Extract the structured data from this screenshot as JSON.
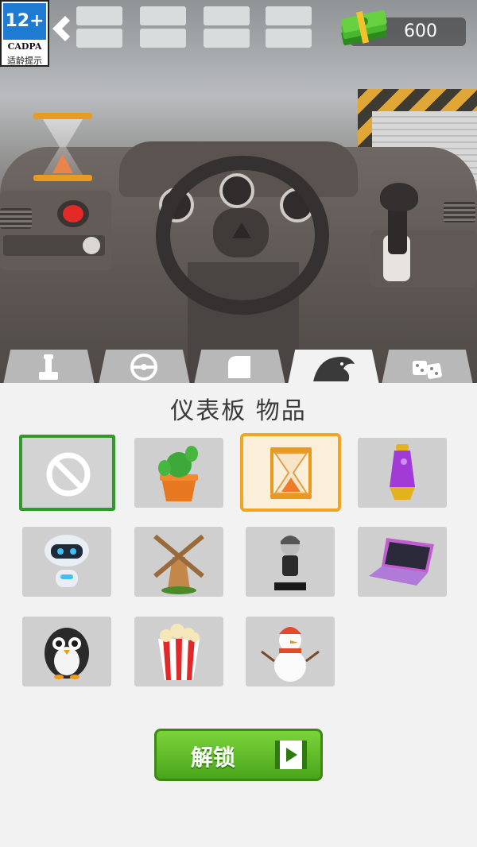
{
  "age_rating": {
    "label": "12+",
    "org": "CADPA",
    "tip": "适龄提示"
  },
  "currency": {
    "value": "600",
    "icon": "cash-stack-icon"
  },
  "tabs": [
    {
      "icon": "gear-shifter-icon",
      "active": false
    },
    {
      "icon": "steering-wheel-icon",
      "active": false
    },
    {
      "icon": "seat-icon",
      "active": false
    },
    {
      "icon": "lion-emblem-icon",
      "active": true
    },
    {
      "icon": "dice-icon",
      "active": false
    }
  ],
  "panel": {
    "title": "仪表板 物品"
  },
  "items": [
    {
      "icon": "none-prohibited-icon",
      "state": "equipped"
    },
    {
      "icon": "cactus-icon",
      "state": "locked"
    },
    {
      "icon": "hourglass-icon",
      "state": "selected"
    },
    {
      "icon": "lava-lamp-icon",
      "state": "locked"
    },
    {
      "icon": "robot-icon",
      "state": "locked"
    },
    {
      "icon": "windmill-icon",
      "state": "locked"
    },
    {
      "icon": "figurine-icon",
      "state": "locked"
    },
    {
      "icon": "laptop-icon",
      "state": "locked"
    },
    {
      "icon": "penguin-icon",
      "state": "locked"
    },
    {
      "icon": "popcorn-icon",
      "state": "locked"
    },
    {
      "icon": "snowman-icon",
      "state": "locked"
    }
  ],
  "unlock": {
    "label": "解锁",
    "icon": "video-play-icon"
  },
  "colors": {
    "equipped_border": "#2e9a2c",
    "selected_border": "#f3a521",
    "unlock_green": "#5cbb25"
  }
}
